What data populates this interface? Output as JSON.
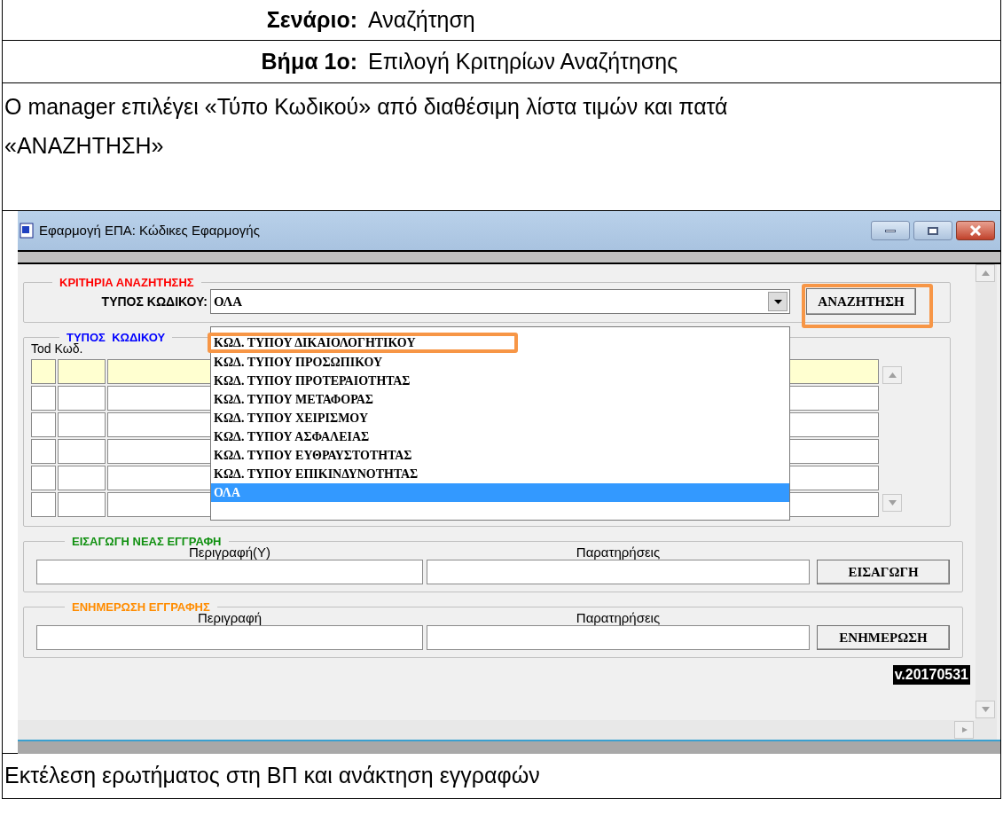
{
  "document": {
    "rows": [
      {
        "label": "Σενάριο:",
        "value": "Αναζήτηση"
      },
      {
        "label": "Βήμα 1ο:",
        "value": "Επιλογή Κριτηρίων Αναζήτησης"
      }
    ],
    "description": "Ο manager επιλέγει «Τύπο Κωδικού» από διαθέσιμη λίστα τιμών και πατά «ΑΝΑΖΗΤΗΣΗ»",
    "footer": "Εκτέλεση ερωτήματος στη ΒΠ και ανάκτηση εγγραφών"
  },
  "window": {
    "title": "Εφαρμογή ΕΠΑ: Κώδικες Εφαρμογής"
  },
  "criteria": {
    "legend": "ΚΡΙΤΗΡΙΑ ΑΝΑΖΗΤΗΣΗΣ",
    "label": "ΤΥΠΟΣ ΚΩΔΙΚΟΥ:",
    "value": "ΟΛΑ",
    "expanded": true,
    "button": {
      "label": "ΑΝΑΖΗΤΗΣΗ",
      "highlighted": true
    }
  },
  "options": [
    {
      "label": "ΚΩΔ. ΤΥΠΟΥ ΔΙΚΑΙΟΛΟΓΗΤΙΚΟΥ",
      "selected": false,
      "highlighted": true
    },
    {
      "label": "ΚΩΔ. ΤΥΠΟΥ ΠΡΟΣΩΠΙΚΟΥ",
      "selected": false,
      "highlighted": false
    },
    {
      "label": "ΚΩΔ. ΤΥΠΟΥ ΠΡΟΤΕΡΑΙΟΤΗΤΑΣ",
      "selected": false,
      "highlighted": false
    },
    {
      "label": "ΚΩΔ. ΤΥΠΟΥ ΜΕΤΑΦΟΡΑΣ",
      "selected": false,
      "highlighted": false
    },
    {
      "label": "ΚΩΔ. ΤΥΠΟΥ ΧΕΙΡΙΣΜΟΥ",
      "selected": false,
      "highlighted": false
    },
    {
      "label": "ΚΩΔ. ΤΥΠΟΥ ΑΣΦΑΛΕΙΑΣ",
      "selected": false,
      "highlighted": false
    },
    {
      "label": "ΚΩΔ. ΤΥΠΟΥ ΕΥΘΡΑΥΣΤΟΤΗΤΑΣ",
      "selected": false,
      "highlighted": false
    },
    {
      "label": "ΚΩΔ. ΤΥΠΟΥ ΕΠΙΚΙΝΔΥΝΟΤΗΤΑΣ",
      "selected": false,
      "highlighted": false
    },
    {
      "label": "ΟΛΑ",
      "selected": true,
      "highlighted": false
    }
  ],
  "grid": {
    "legend": "ΤΥΠΟΣ  ΚΩΔΙΚΟΥ",
    "columns": [
      "Tod",
      "Κωδ."
    ],
    "rows": [
      {
        "selected": true
      },
      {
        "selected": false
      },
      {
        "selected": false
      },
      {
        "selected": false
      },
      {
        "selected": false
      },
      {
        "selected": false
      }
    ]
  },
  "insert": {
    "legend": "ΕΙΣΑΓΩΓΗ ΝΕΑΣ ΕΓΓΡΑΦΗ",
    "fields": [
      "Περιγραφή(Υ)",
      "Παρατηρήσεις"
    ],
    "button": "ΕΙΣΑΓΩΓΗ"
  },
  "update": {
    "legend": "ΕΝΗΜΕΡΩΣΗ ΕΓΓΡΑΦΗΣ",
    "fields": [
      "Περιγραφή",
      "Παρατηρήσεις"
    ],
    "button": "ΕΝΗΜΕΡΩΣΗ"
  },
  "version": "v.20170531"
}
